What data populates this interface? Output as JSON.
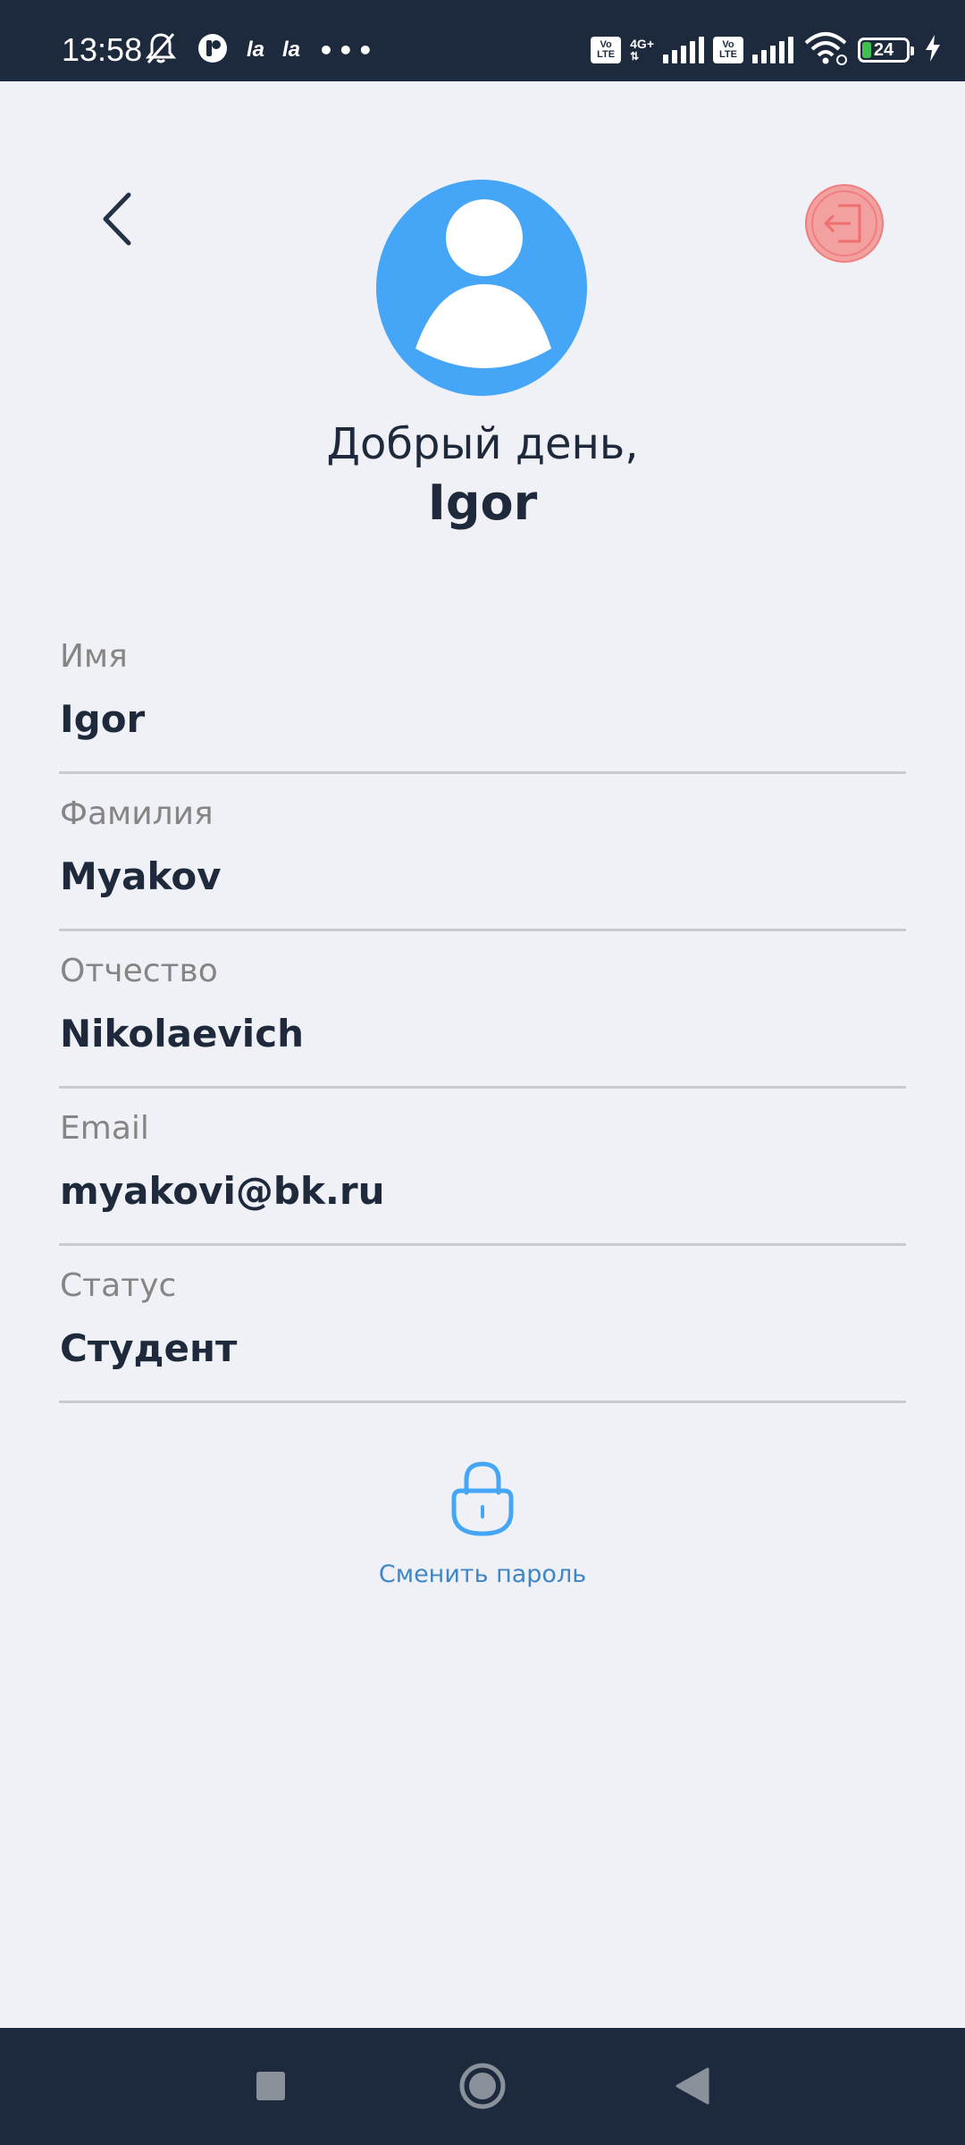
{
  "status_bar": {
    "time": "13:58",
    "app_icon_1": "la",
    "app_icon_2": "la",
    "more": "•••",
    "volte_1_top": "Vo",
    "volte_1_bottom": "LTE",
    "network_type": "4G+",
    "volte_2_top": "Vo",
    "volte_2_bottom": "LTE",
    "battery_level": "24",
    "icons": [
      "muted-bell-icon",
      "app-notification-icon",
      "volte-icon",
      "signal-icon",
      "wifi-icon",
      "battery-icon",
      "charging-icon"
    ]
  },
  "header": {
    "greeting": "Добрый день,",
    "username": "Igor",
    "back_icon": "chevron-left-icon",
    "logout_icon": "logout-icon",
    "logout_color": "#f08a8a",
    "avatar_color": "#45a6f8"
  },
  "profile": {
    "fields": [
      {
        "label": "Имя",
        "value": "Igor"
      },
      {
        "label": "Фамилия",
        "value": "Myakov"
      },
      {
        "label": "Отчество",
        "value": "Nikolaevich"
      },
      {
        "label": "Email",
        "value": "myakovi@bk.ru"
      },
      {
        "label": "Статус",
        "value": "Студент"
      }
    ]
  },
  "change_password": {
    "label": "Сменить пароль",
    "icon": "lock-icon",
    "color": "#45a6f8"
  },
  "nav_bar": {
    "buttons": [
      "recents-icon",
      "home-icon",
      "back-icon"
    ]
  }
}
